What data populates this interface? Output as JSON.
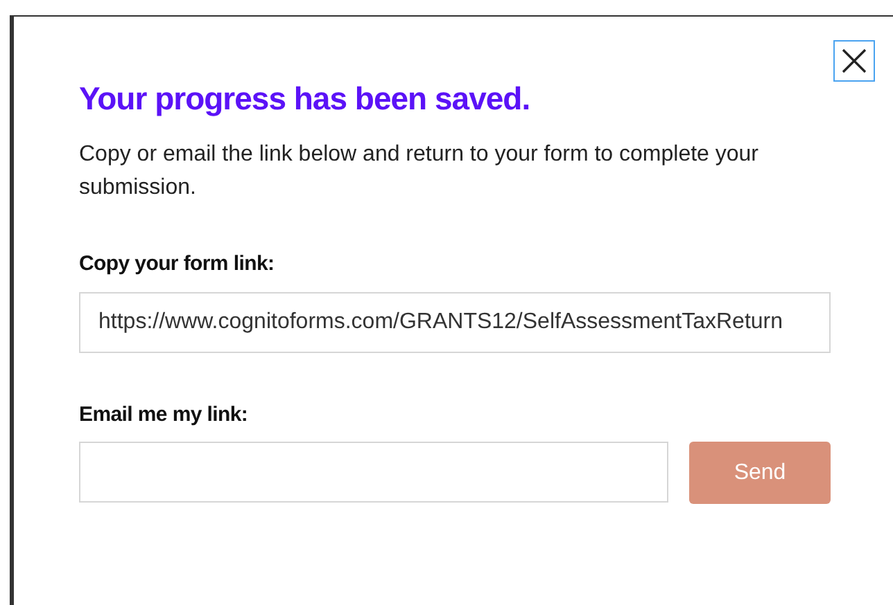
{
  "dialog": {
    "title": "Your progress has been saved.",
    "message": "Copy or email the link below and return to your form to complete your submission.",
    "link_field": {
      "label": "Copy your form link:",
      "value": "https://www.cognitoforms.com/GRANTS12/SelfAssessmentTaxReturn"
    },
    "email_field": {
      "label": "Email me my link:"
    },
    "send_button": {
      "label": "Send",
      "disabled": true
    }
  }
}
